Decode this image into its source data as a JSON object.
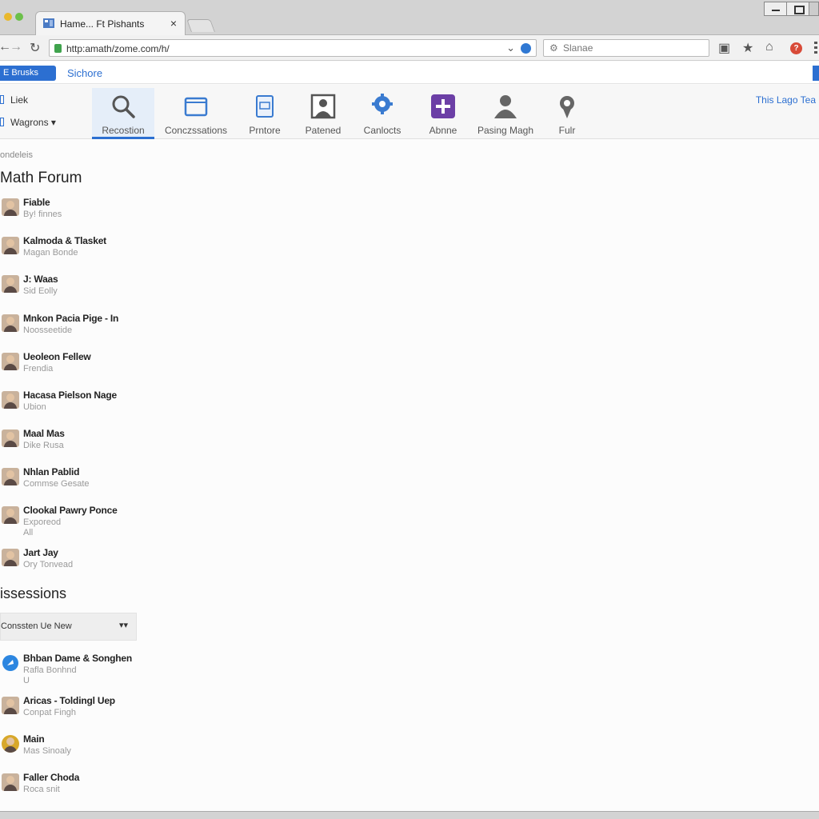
{
  "browser": {
    "tab_title": "Hame... Ft Pishants",
    "tab_close": "×",
    "url": "http:amath/zome.com/h/",
    "search_placeholder": "Slanae",
    "icons": [
      "back-icon",
      "forward-icon",
      "reload-icon",
      "lock-icon",
      "search-icon",
      "extension-icon",
      "star-icon",
      "home-icon",
      "alert-icon",
      "menu-icon"
    ]
  },
  "appbar": {
    "button_label": "E Brusks",
    "link_label": "Sichore"
  },
  "nav": {
    "side_links": [
      {
        "label": "Liek"
      },
      {
        "label": "Wagrons ▾"
      }
    ],
    "items": [
      {
        "label": "Recostion",
        "icon": "search-icon",
        "active": true
      },
      {
        "label": "Conczssations",
        "icon": "window-icon"
      },
      {
        "label": "Prntore",
        "icon": "document-icon"
      },
      {
        "label": "Patened",
        "icon": "portrait-icon"
      },
      {
        "label": "Canlocts",
        "icon": "gear-icon"
      },
      {
        "label": "Abnne",
        "icon": "add-icon"
      },
      {
        "label": "Pasing Magh",
        "icon": "user-icon"
      },
      {
        "label": "Fulr",
        "icon": "settings-icon"
      }
    ],
    "right_text": "This Lago Tea"
  },
  "content": {
    "breadcrumb": "ondeleis",
    "forum_title": "Math Forum",
    "members": [
      {
        "name": "Fiable",
        "sub": "By! finnes"
      },
      {
        "name": "Kalmoda & Tlasket",
        "sub": "Magan Bonde"
      },
      {
        "name": "J: Waas",
        "sub": "Sid Eolly"
      },
      {
        "name": "Mnkon Pacia Pige - In",
        "sub": "Noosseetide"
      },
      {
        "name": "Ueoleon Fellew",
        "sub": "Frendia"
      },
      {
        "name": "Hacasa Pielson Nage",
        "sub": "Ubion"
      },
      {
        "name": "Maal Mas",
        "sub": "Dike Rusa"
      },
      {
        "name": "Nhlan Pablid",
        "sub": "Commse Gesate"
      },
      {
        "name": "Clookal Pawry Ponce",
        "sub": "Exporeod",
        "sub2": "All"
      },
      {
        "name": "Jart Jay",
        "sub": "Ory Tonvead"
      }
    ],
    "discussions_title": "issessions",
    "filter_label": "Conssten Ue New",
    "filter_arrow": "▾▾",
    "discussions": [
      {
        "name": "Bhban Dame & Songhen",
        "sub": "Rafla Bonhnd",
        "sub2": "U"
      },
      {
        "name": "Aricas - Toldingl Uep",
        "sub": "Conpat Fingh"
      },
      {
        "name": "Main",
        "sub": "Mas Sinoaly"
      },
      {
        "name": "Faller Choda",
        "sub": "Roca snit"
      }
    ]
  }
}
